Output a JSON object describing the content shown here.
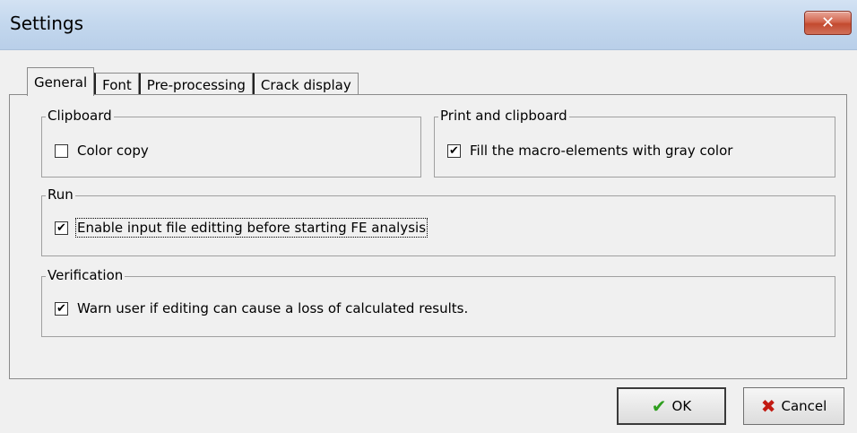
{
  "window": {
    "title": "Settings",
    "close_symbol": "✕"
  },
  "tabs": [
    {
      "label": "General"
    },
    {
      "label": "Font"
    },
    {
      "label": "Pre-processing"
    },
    {
      "label": "Crack display"
    }
  ],
  "groups": {
    "clipboard": {
      "label": "Clipboard",
      "items": [
        {
          "label": "Color copy",
          "checked": false
        }
      ]
    },
    "print_clipboard": {
      "label": "Print and clipboard",
      "items": [
        {
          "label": "Fill the macro-elements with gray color",
          "checked": true
        }
      ]
    },
    "run": {
      "label": "Run",
      "items": [
        {
          "label": "Enable input file editting before starting FE analysis",
          "checked": true
        }
      ]
    },
    "verification": {
      "label": "Verification",
      "items": [
        {
          "label": "Warn user if editing can cause a loss of calculated results.",
          "checked": true
        }
      ]
    }
  },
  "buttons": {
    "ok_label": "OK",
    "cancel_label": "Cancel"
  },
  "icons": {
    "ok": "checkmark-icon",
    "cancel": "x-icon"
  },
  "check_mark": "✔"
}
